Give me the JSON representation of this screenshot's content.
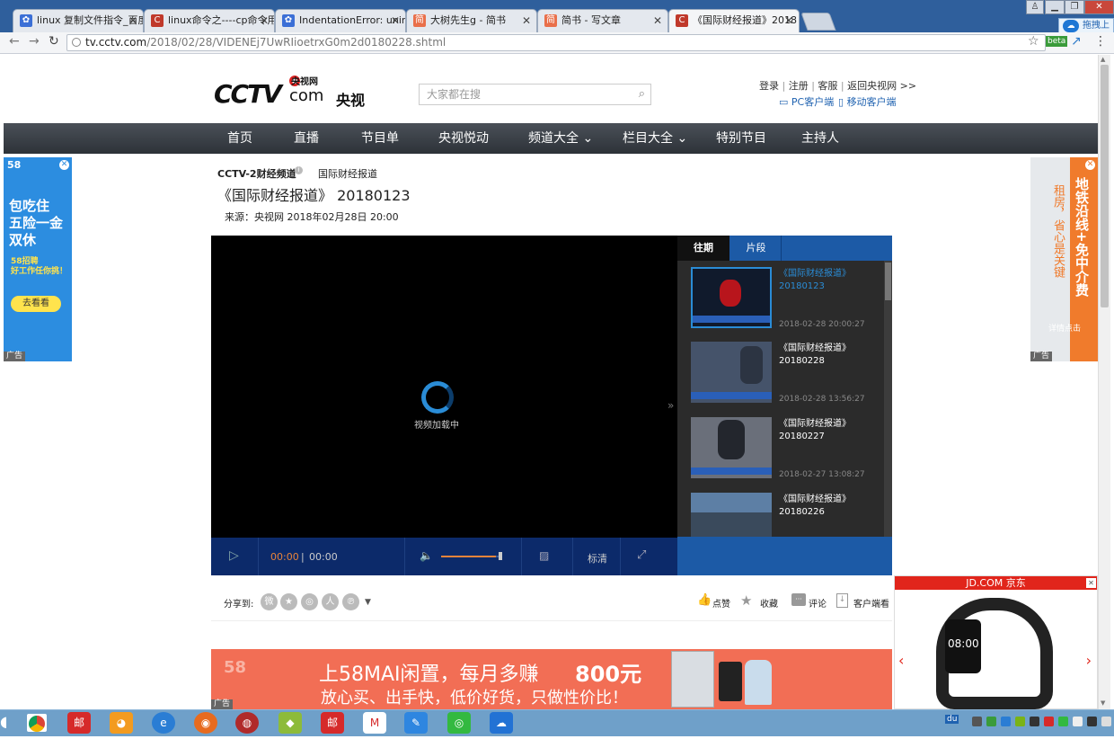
{
  "browser": {
    "tabs": [
      {
        "label": "linux 复制文件指令_百度",
        "icon_color": "#3b6fd6",
        "icon": "paw-icon"
      },
      {
        "label": "linux命令之----cp命令用",
        "icon_color": "#c0392b",
        "icon": "c-logo-icon"
      },
      {
        "label": "IndentationError: uninc",
        "icon_color": "#3b6fd6",
        "icon": "paw-icon"
      },
      {
        "label": "大树先生g - 简书",
        "icon_color": "#e96f4a",
        "icon": "jianshu-icon"
      },
      {
        "label": "简书 - 写文章",
        "icon_color": "#e96f4a",
        "icon": "jianshu-icon"
      },
      {
        "label": "《国际财经报道》2018",
        "icon_color": "#c0392b",
        "icon": "c-logo-icon"
      }
    ],
    "url_host": "tv.cctv.com",
    "url_path": "/2018/02/28/VIDENEj7UwRIioetrxG0m2d0180228.shtml",
    "ext_label": "拖拽上",
    "beta_label": "beta"
  },
  "header": {
    "logo_main": "CCTV",
    "logo_top": "央视网",
    "logo_com": "com",
    "logo_cn": "央视",
    "search_placeholder": "大家都在搜",
    "links": [
      "登录",
      "注册",
      "客服",
      "返回央视网 >>"
    ],
    "pc_client": "PC客户端",
    "mobile_client": "移动客户端"
  },
  "nav": [
    "首页",
    "直播",
    "节目单",
    "央视悦动",
    "频道大全 ⌄",
    "栏目大全 ⌄",
    "特别节目",
    "主持人"
  ],
  "video": {
    "channel": "CCTV-2财经频道",
    "program": "国际财经报道",
    "title": "《国际财经报道》 20180123",
    "source": "来源：央视网 2018年02月28日 20:00",
    "loading": "视频加载中",
    "time_current": "00:00",
    "time_total": "00:00",
    "quality": "标清",
    "volume_level": 0.9
  },
  "playlist": {
    "tabs": [
      "往期",
      "片段"
    ],
    "items": [
      {
        "title": "《国际财经报道》",
        "date": "20180123",
        "time": "2018-02-28 20:00:27"
      },
      {
        "title": "《国际财经报道》",
        "date": "20180228",
        "time": "2018-02-28 13:56:27"
      },
      {
        "title": "《国际财经报道》",
        "date": "20180227",
        "time": "2018-02-27 13:08:27"
      },
      {
        "title": "《国际财经报道》",
        "date": "20180226",
        "time": ""
      }
    ]
  },
  "share": {
    "label": "分享到:",
    "like": "点赞",
    "fav": "收藏",
    "comment": "评论",
    "client": "客户端看"
  },
  "ads": {
    "left_brand": "58",
    "left_lines": [
      "包吃住",
      "五险一金",
      "双休"
    ],
    "left_sub": "58招聘",
    "left_sub2": "好工作任你挑！",
    "left_btn": "去看看",
    "ad_tag": "广告",
    "right_line1": "租房，省心是关键",
    "right_line2": "地铁沿线+免中介费",
    "right_btn": "详情点击",
    "banner_brand": "58",
    "banner_line1": "上58MAI闲置，每月多赚",
    "banner_amount": "800元",
    "banner_line2": "放心买、出手快，低价好货，只做性价比！",
    "jd_label": "JD.COM 京东",
    "jd_time": "08:00"
  }
}
